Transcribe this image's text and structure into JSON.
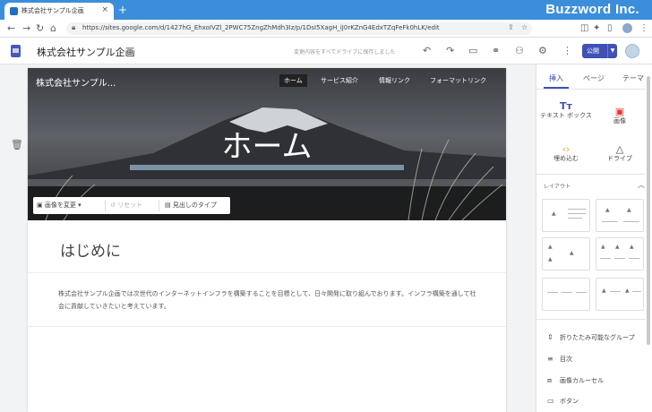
{
  "browser": {
    "tab_title": "株式会社サンプル企画",
    "tab_close": "×",
    "new_tab": "+",
    "url": "https://sites.google.com/d/1427hG_EhxoIVZl_2PWC75ZngZhMdh3Iz/p/1DsI5XagH_iJ0rKZnG4EdxTZqFeFk0hLK/edit",
    "watermark": "Buzzword Inc."
  },
  "header": {
    "title": "株式会社サンプル企画",
    "save_status": "変更内容をすべてドライブに保存しました",
    "publish_label": "公開",
    "icons": [
      "undo-icon",
      "redo-icon",
      "preview-icon",
      "link-icon",
      "share-icon",
      "settings-icon",
      "more-icon"
    ]
  },
  "hero": {
    "site_name": "株式会社サンプル...",
    "nav": [
      "ホーム",
      "サービス紹介",
      "情報リンク",
      "フォーマットリンク"
    ],
    "active_nav": "ホーム",
    "title": "ホーム",
    "toolbar": {
      "change_image": "画像を変更",
      "reset": "リセット",
      "header_type": "見出しのタイプ"
    }
  },
  "content": {
    "heading": "はじめに",
    "paragraph": "株式会社サンプル企画では次世代のインターネットインフラを構築することを目標として、日々開発に取り組んでおります。インフラ構築を通して社会に貢献していきたいと考えています。"
  },
  "panel": {
    "tabs": [
      "挿入",
      "ページ",
      "テーマ"
    ],
    "active_tab": "挿入",
    "insert_items": [
      {
        "label": "テキスト ボックス",
        "icon": "text-box-icon"
      },
      {
        "label": "画像",
        "icon": "image-icon"
      },
      {
        "label": "埋め込む",
        "icon": "embed-icon"
      },
      {
        "label": "ドライブ",
        "icon": "drive-icon"
      }
    ],
    "layout_title": "レイアウト",
    "more_items": [
      {
        "label": "折りたたみ可能なグループ",
        "icon": "collapsible-icon"
      },
      {
        "label": "目次",
        "icon": "toc-icon"
      },
      {
        "label": "画像カルーセル",
        "icon": "carousel-icon"
      },
      {
        "label": "ボタン",
        "icon": "button-icon"
      }
    ]
  },
  "colors": {
    "accent": "#3f51b5",
    "chrome_blue": "#3b8ed9"
  }
}
